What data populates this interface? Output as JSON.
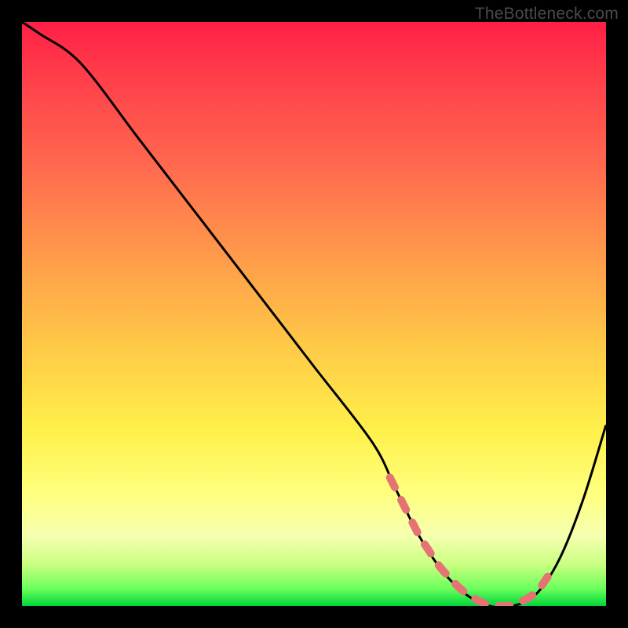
{
  "watermark": "TheBottleneck.com",
  "colors": {
    "frame": "#000000",
    "curve": "#000000",
    "dash": "#e57373",
    "gradient_stops": [
      "#ff1f46",
      "#ff3a4a",
      "#ff6a4e",
      "#ff9a4a",
      "#ffc847",
      "#fff04a",
      "#ffff7a",
      "#f6ffb0",
      "#c8ff80",
      "#6cff5c",
      "#00d63a"
    ]
  },
  "chart_data": {
    "type": "line",
    "title": "",
    "xlabel": "",
    "ylabel": "",
    "xlim": [
      0,
      100
    ],
    "ylim": [
      0,
      100
    ],
    "series": [
      {
        "name": "curve",
        "x": [
          0,
          3,
          10,
          20,
          30,
          40,
          50,
          60,
          64,
          68,
          72,
          76,
          80,
          84,
          88,
          92,
          96,
          100
        ],
        "values": [
          100,
          98,
          93,
          80,
          67,
          54,
          41,
          28,
          20,
          12,
          6,
          2,
          0,
          0,
          2,
          8,
          18,
          31
        ]
      }
    ],
    "flat_band": {
      "x_start": 63,
      "x_end": 90,
      "y": 2,
      "style": "dashed",
      "color": "#e57373"
    }
  }
}
